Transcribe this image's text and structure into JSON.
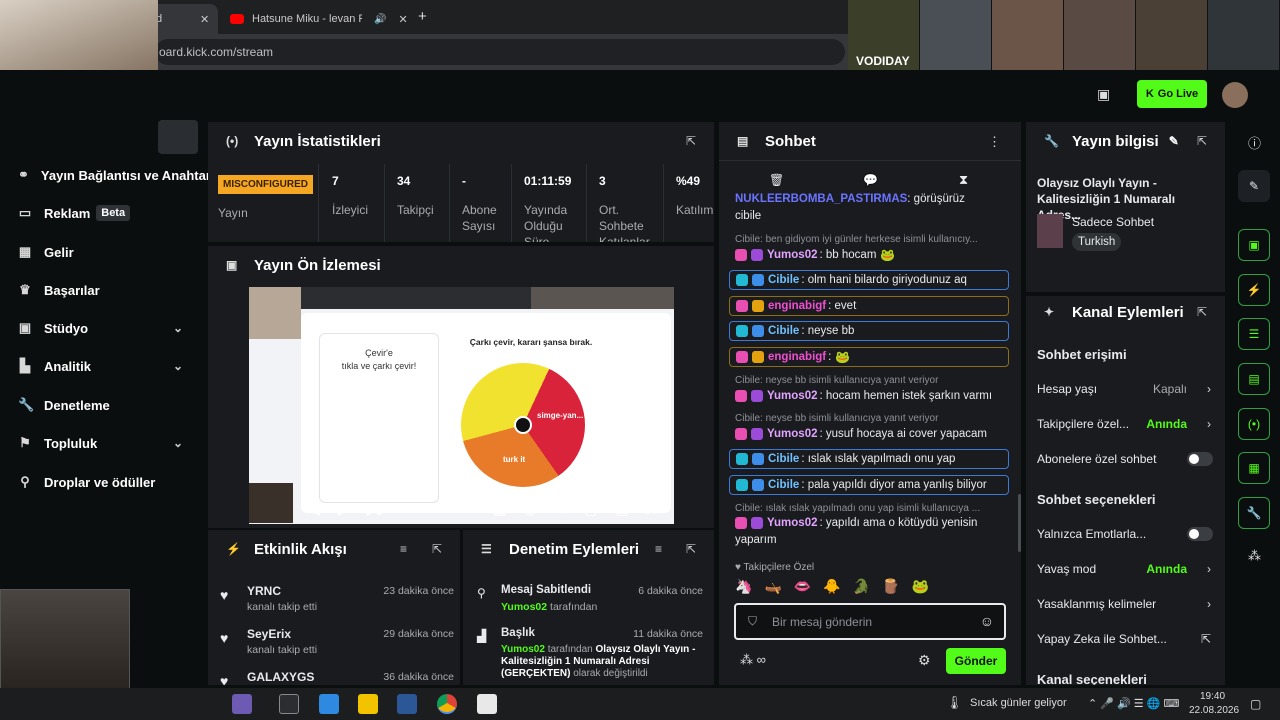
{
  "browser": {
    "tab1_title": "d",
    "tab2_title": "Hatsune Miku - levan Polkk",
    "close_glyph": "✕",
    "new_tab": "+",
    "url": "oard.kick.com/stream"
  },
  "cams": {
    "label": "VODIDAY"
  },
  "topbar": {
    "go_live": "Go Live"
  },
  "sidebar": {
    "items": [
      {
        "label": "Yayın Bağlantısı ve Anahtar",
        "icon": "link-icon"
      },
      {
        "label": "Reklam",
        "icon": "ad-icon",
        "badge": "Beta"
      },
      {
        "label": "Gelir",
        "icon": "revenue-icon"
      },
      {
        "label": "Başarılar",
        "icon": "trophy-icon"
      },
      {
        "label": "Stüdyo",
        "icon": "studio-icon"
      },
      {
        "label": "Analitik",
        "icon": "analytics-icon"
      },
      {
        "label": "Denetleme",
        "icon": "wrench-icon"
      },
      {
        "label": "Topluluk",
        "icon": "community-icon"
      },
      {
        "label": "Droplar ve ödüller",
        "icon": "drops-icon"
      }
    ]
  },
  "stats": {
    "title": "Yayın İstatistikleri",
    "status_badge": "MISCONFIGURED",
    "status_label": "Yayın",
    "items": [
      {
        "value": "7",
        "label": "İzleyici"
      },
      {
        "value": "34",
        "label": "Takipçi"
      },
      {
        "value": "-",
        "label": "Abone Sayısı"
      },
      {
        "value": "01:11:59",
        "label": "Yayında Olduğu Süre"
      },
      {
        "value": "3",
        "label": "Ort. Sohbete Katılanlar"
      },
      {
        "value": "%49",
        "label": "Katılım"
      }
    ]
  },
  "preview": {
    "title": "Yayın Ön İzlemesi",
    "wheel_heading": "Çarkı çevir, kararı şansa bırak.",
    "left_heading": "Çevir'e",
    "left_sub": "tıkla ve çarkı çevir!",
    "slice_text": "simge-yan...",
    "slice_text2": "turk it"
  },
  "events": {
    "title": "Etkinlik Akışı",
    "items": [
      {
        "user": "YRNC",
        "desc": "kanalı takip etti",
        "time": "23 dakika önce"
      },
      {
        "user": "SeyErix",
        "desc": "kanalı takip etti",
        "time": "29 dakika önce"
      },
      {
        "user": "GALAXYGS",
        "desc": "",
        "time": "36 dakika önce"
      }
    ]
  },
  "moderation": {
    "title": "Denetim Eylemleri",
    "items": [
      {
        "title": "Mesaj Sabitlendi",
        "user": "Yumos02",
        "suffix": "tarafından",
        "time": "6 dakika önce"
      },
      {
        "title": "Başlık",
        "user": "Yumos02",
        "suffix": "tarafından",
        "detail": "Olaysız Olaylı Yayın - Kalitesizliğin 1 Numaralı Adresi (GERÇEKTEN)",
        "detail_suffix": "olarak değiştirildi",
        "time": "11 dakika önce"
      }
    ]
  },
  "chat": {
    "title": "Sohbet",
    "top_partial_user": "NUKLEERBOMBA_PASTIRMAS",
    "top_partial_text": ": görüşürüz",
    "top_partial_text2": "cibile",
    "messages": [
      {
        "reply": "Cibile: ben gidiyom iyi günler herkese isimli kullanıcıy...",
        "user": "Yumos02",
        "text": ": bb hocam",
        "color": "#e2a2ff"
      },
      {
        "user": "Cibile",
        "text": ": olm hani bilardo giriyodunuz aq",
        "color": "#6ec1ff"
      },
      {
        "user": "enginabigf",
        "text": ": evet",
        "color": "#f04fd0"
      },
      {
        "user": "Cibile",
        "text": ": neyse bb",
        "color": "#6ec1ff"
      },
      {
        "user": "enginabigf",
        "text": ":",
        "color": "#f04fd0"
      },
      {
        "reply": "Cibile: neyse bb isimli kullanıcıya yanıt veriyor",
        "user": "Yumos02",
        "text": ": hocam hemen istek şarkın varmı",
        "color": "#e2a2ff"
      },
      {
        "reply": "Cibile: neyse bb isimli kullanıcıya yanıt veriyor",
        "user": "Yumos02",
        "text": ": yusuf hocaya ai cover yapacam",
        "color": "#e2a2ff"
      },
      {
        "user": "Cibile",
        "text": ": ıslak ıslak yapılmadı onu yap",
        "color": "#6ec1ff"
      },
      {
        "user": "Cibile",
        "text": ": pala yapıldı diyor ama yanlış biliyor",
        "color": "#6ec1ff"
      },
      {
        "reply": "Cibile: ıslak ıslak yapılmadı onu yap isimli kullanıcıya ...",
        "user": "Yumos02",
        "text": ": yapıldı ama o kötüydü yenisin",
        "text2": "yaparım",
        "color": "#e2a2ff"
      }
    ],
    "followers_only": "Takipçilere Özel",
    "input_placeholder": "Bir mesaj gönderin",
    "send": "Gönder"
  },
  "stream_info": {
    "title": "Yayın bilgisi",
    "stream_title": "Olaysız Olaylı Yayın - Kalitesizliğin 1 Numaralı Adres...",
    "category": "Sadece Sohbet",
    "language": "Turkish"
  },
  "channel_actions": {
    "title": "Kanal Eylemleri",
    "section1": "Sohbet erişimi",
    "rows1": [
      {
        "label": "Hesap yaşı",
        "value": "Kapalı",
        "kind": "arrow",
        "value_color": "#a9abaf"
      },
      {
        "label": "Takipçilere özel...",
        "value": "Anında",
        "kind": "arrow",
        "value_color": "#53fc18"
      },
      {
        "label": "Abonelere özel sohbet",
        "value": "",
        "kind": "toggle"
      }
    ],
    "section2": "Sohbet seçenekleri",
    "rows2": [
      {
        "label": "Yalnızca Emotlarla...",
        "value": "",
        "kind": "toggle"
      },
      {
        "label": "Yavaş mod",
        "value": "Anında",
        "kind": "arrow",
        "value_color": "#53fc18"
      },
      {
        "label": "Yasaklanmış kelimeler",
        "value": "",
        "kind": "arrow"
      },
      {
        "label": "Yapay Zeka ile Sohbet...",
        "value": "",
        "kind": "external"
      }
    ],
    "section3": "Kanal seçenekleri"
  },
  "taskbar": {
    "weather": "Sıcak günler geliyor",
    "time": "19:40",
    "date": "22.08.2026"
  },
  "colors": {
    "accent": "#53fc18",
    "panel": "#191b1f",
    "bg": "#0b0e0f",
    "warning": "#f5a623"
  }
}
